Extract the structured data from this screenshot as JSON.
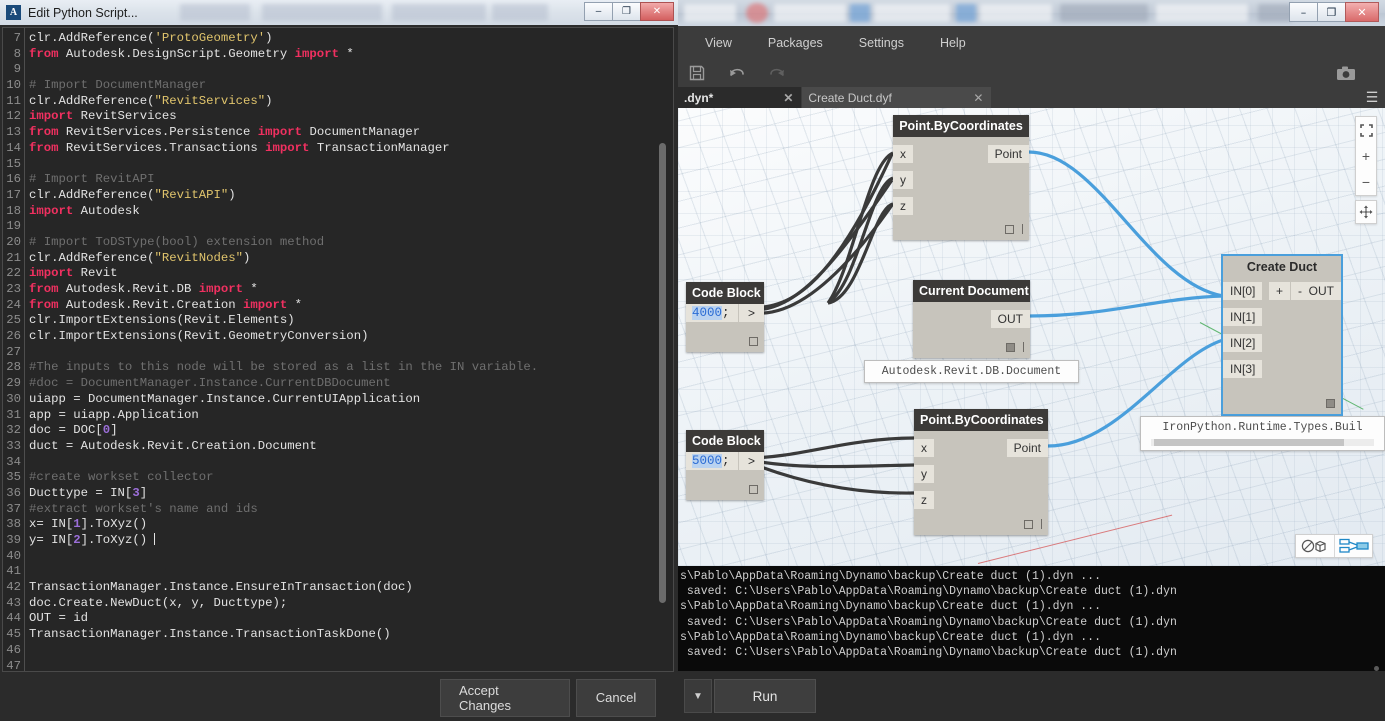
{
  "python_editor": {
    "title": "Edit Python Script...",
    "icon": "autodesk-logo-icon",
    "window_buttons": {
      "minimize": "–",
      "maximize": "❐",
      "close": "✕"
    },
    "accept_label": "Accept Changes",
    "cancel_label": "Cancel",
    "code_lines": [
      {
        "n": "7",
        "tokens": [
          {
            "t": "clr.AddReference(",
            "c": "plain"
          },
          {
            "t": "'ProtoGeometry'",
            "c": "str"
          },
          {
            "t": ")",
            "c": "plain"
          }
        ]
      },
      {
        "n": "8",
        "tokens": [
          {
            "t": "from",
            "c": "kw"
          },
          {
            "t": " Autodesk.DesignScript.Geometry ",
            "c": "plain"
          },
          {
            "t": "import",
            "c": "kw"
          },
          {
            "t": " *",
            "c": "plain"
          }
        ]
      },
      {
        "n": "9",
        "tokens": []
      },
      {
        "n": "10",
        "tokens": [
          {
            "t": "# Import DocumentManager",
            "c": "com"
          }
        ]
      },
      {
        "n": "11",
        "tokens": [
          {
            "t": "clr.AddReference(",
            "c": "plain"
          },
          {
            "t": "\"RevitServices\"",
            "c": "str"
          },
          {
            "t": ")",
            "c": "plain"
          }
        ]
      },
      {
        "n": "12",
        "tokens": [
          {
            "t": "import",
            "c": "kw"
          },
          {
            "t": " RevitServices",
            "c": "plain"
          }
        ]
      },
      {
        "n": "13",
        "tokens": [
          {
            "t": "from",
            "c": "kw"
          },
          {
            "t": " RevitServices.Persistence ",
            "c": "plain"
          },
          {
            "t": "import",
            "c": "kw"
          },
          {
            "t": " DocumentManager",
            "c": "plain"
          }
        ]
      },
      {
        "n": "14",
        "tokens": [
          {
            "t": "from",
            "c": "kw"
          },
          {
            "t": " RevitServices.Transactions ",
            "c": "plain"
          },
          {
            "t": "import",
            "c": "kw"
          },
          {
            "t": " TransactionManager",
            "c": "plain"
          }
        ]
      },
      {
        "n": "15",
        "tokens": []
      },
      {
        "n": "16",
        "tokens": [
          {
            "t": "# Import RevitAPI",
            "c": "com"
          }
        ]
      },
      {
        "n": "17",
        "tokens": [
          {
            "t": "clr.AddReference(",
            "c": "plain"
          },
          {
            "t": "\"RevitAPI\"",
            "c": "str"
          },
          {
            "t": ")",
            "c": "plain"
          }
        ]
      },
      {
        "n": "18",
        "tokens": [
          {
            "t": "import",
            "c": "kw"
          },
          {
            "t": " Autodesk",
            "c": "plain"
          }
        ]
      },
      {
        "n": "19",
        "tokens": []
      },
      {
        "n": "20",
        "tokens": [
          {
            "t": "# Import ToDSType(bool) extension method",
            "c": "com"
          }
        ]
      },
      {
        "n": "21",
        "tokens": [
          {
            "t": "clr.AddReference(",
            "c": "plain"
          },
          {
            "t": "\"RevitNodes\"",
            "c": "str"
          },
          {
            "t": ")",
            "c": "plain"
          }
        ]
      },
      {
        "n": "22",
        "tokens": [
          {
            "t": "import",
            "c": "kw"
          },
          {
            "t": " Revit",
            "c": "plain"
          }
        ]
      },
      {
        "n": "23",
        "tokens": [
          {
            "t": "from",
            "c": "kw"
          },
          {
            "t": " Autodesk.Revit.DB ",
            "c": "plain"
          },
          {
            "t": "import",
            "c": "kw"
          },
          {
            "t": " *",
            "c": "plain"
          }
        ]
      },
      {
        "n": "24",
        "tokens": [
          {
            "t": "from",
            "c": "kw"
          },
          {
            "t": " Autodesk.Revit.Creation ",
            "c": "plain"
          },
          {
            "t": "import",
            "c": "kw"
          },
          {
            "t": " *",
            "c": "plain"
          }
        ]
      },
      {
        "n": "25",
        "tokens": [
          {
            "t": "clr.ImportExtensions(Revit.Elements)",
            "c": "plain"
          }
        ]
      },
      {
        "n": "26",
        "tokens": [
          {
            "t": "clr.ImportExtensions(Revit.GeometryConversion)",
            "c": "plain"
          }
        ]
      },
      {
        "n": "27",
        "tokens": []
      },
      {
        "n": "28",
        "tokens": [
          {
            "t": "#The inputs to this node will be stored as a list in the IN variable.",
            "c": "com"
          }
        ]
      },
      {
        "n": "29",
        "tokens": [
          {
            "t": "#doc = DocumentManager.Instance.CurrentDBDocument",
            "c": "com"
          }
        ]
      },
      {
        "n": "30",
        "tokens": [
          {
            "t": "uiapp = DocumentManager.Instance.CurrentUIApplication",
            "c": "plain"
          }
        ]
      },
      {
        "n": "31",
        "tokens": [
          {
            "t": "app = uiapp.Application",
            "c": "plain"
          }
        ]
      },
      {
        "n": "32",
        "tokens": [
          {
            "t": "doc = DOC[",
            "c": "plain"
          },
          {
            "t": "0",
            "c": "num"
          },
          {
            "t": "]",
            "c": "plain"
          }
        ]
      },
      {
        "n": "33",
        "tokens": [
          {
            "t": "duct = Autodesk.Revit.Creation.Document",
            "c": "plain"
          }
        ]
      },
      {
        "n": "34",
        "tokens": []
      },
      {
        "n": "35",
        "tokens": [
          {
            "t": "#create workset collector",
            "c": "com"
          }
        ]
      },
      {
        "n": "36",
        "tokens": [
          {
            "t": "Ducttype = IN[",
            "c": "plain"
          },
          {
            "t": "3",
            "c": "num"
          },
          {
            "t": "]",
            "c": "plain"
          }
        ]
      },
      {
        "n": "37",
        "tokens": [
          {
            "t": "#extract workset's name and ids",
            "c": "com"
          }
        ]
      },
      {
        "n": "38",
        "tokens": [
          {
            "t": "x= IN[",
            "c": "plain"
          },
          {
            "t": "1",
            "c": "num"
          },
          {
            "t": "].ToXyz()",
            "c": "plain"
          }
        ]
      },
      {
        "n": "39",
        "tokens": [
          {
            "t": "y= IN[",
            "c": "plain"
          },
          {
            "t": "2",
            "c": "num"
          },
          {
            "t": "].ToXyz() ",
            "c": "plain"
          },
          {
            "t": "|",
            "c": "caret"
          }
        ]
      },
      {
        "n": "40",
        "tokens": []
      },
      {
        "n": "41",
        "tokens": []
      },
      {
        "n": "42",
        "tokens": [
          {
            "t": "TransactionManager.Instance.EnsureInTransaction(doc)",
            "c": "plain"
          }
        ]
      },
      {
        "n": "43",
        "tokens": [
          {
            "t": "doc.Create.NewDuct(x, y, Ducttype);",
            "c": "plain"
          }
        ]
      },
      {
        "n": "44",
        "tokens": [
          {
            "t": "OUT = id",
            "c": "plain"
          }
        ]
      },
      {
        "n": "45",
        "tokens": [
          {
            "t": "TransactionManager.Instance.TransactionTaskDone()",
            "c": "plain"
          }
        ]
      },
      {
        "n": "46",
        "tokens": []
      },
      {
        "n": "47",
        "tokens": []
      }
    ]
  },
  "dynamo": {
    "window_buttons": {
      "minimize": "–",
      "maximize": "❐",
      "close": "✕"
    },
    "menu": [
      "View",
      "Packages",
      "Settings",
      "Help"
    ],
    "toolbar": {
      "save": "save-icon",
      "undo": "undo-icon",
      "redo": "redo-icon",
      "screenshot": "camera-icon"
    },
    "tabs": [
      {
        "label": ".dyn*",
        "close": "✕",
        "active": true
      },
      {
        "label": "Create Duct.dyf",
        "close": "✕",
        "active": false
      }
    ],
    "menu_burger": "☰",
    "canvas": {
      "nodes": [
        {
          "id": "point-by-coordinates-1",
          "title": "Point.ByCoordinates",
          "inputs": [
            "x",
            "y",
            "z"
          ],
          "outputs": [
            "Point"
          ],
          "selected": false
        },
        {
          "id": "code-block-1",
          "title": "Code Block",
          "expression": "4000",
          "terminator": ";",
          "arrow": ">",
          "selected": false
        },
        {
          "id": "current-document",
          "title": "Current Document",
          "inputs": [],
          "outputs": [
            "OUT"
          ],
          "selected": false
        },
        {
          "id": "create-duct",
          "title": "Create Duct",
          "inputs": [
            "IN[0]",
            "IN[1]",
            "IN[2]",
            "IN[3]"
          ],
          "outputs": [
            "OUT"
          ],
          "add_port": "+",
          "remove_port": "-",
          "selected": true
        },
        {
          "id": "code-block-2",
          "title": "Code Block",
          "expression": "5000",
          "terminator": ";",
          "arrow": ">",
          "selected": false
        },
        {
          "id": "point-by-coordinates-2",
          "title": "Point.ByCoordinates",
          "inputs": [
            "x",
            "y",
            "z"
          ],
          "outputs": [
            "Point"
          ],
          "selected": false
        }
      ],
      "tooltips": [
        {
          "id": "current-document-preview",
          "text": "Autodesk.Revit.DB.Document"
        },
        {
          "id": "create-duct-preview",
          "text": "IronPython.Runtime.Types.Buil"
        }
      ],
      "zoom_controls": {
        "fit": "fit-to-screen-icon",
        "zoom_in": "+",
        "zoom_out": "−",
        "pan": "pan-icon"
      },
      "view_toggle": {
        "geometry": "geometry-view-icon",
        "graph": "graph-view-icon"
      }
    },
    "console_lines": [
      "s\\Pablo\\AppData\\Roaming\\Dynamo\\backup\\Create duct (1).dyn ...",
      " saved: C:\\Users\\Pablo\\AppData\\Roaming\\Dynamo\\backup\\Create duct (1).dyn",
      "s\\Pablo\\AppData\\Roaming\\Dynamo\\backup\\Create duct (1).dyn ...",
      " saved: C:\\Users\\Pablo\\AppData\\Roaming\\Dynamo\\backup\\Create duct (1).dyn",
      "s\\Pablo\\AppData\\Roaming\\Dynamo\\backup\\Create duct (1).dyn ...",
      " saved: C:\\Users\\Pablo\\AppData\\Roaming\\Dynamo\\backup\\Create duct (1).dyn"
    ],
    "run_bar": {
      "caret": "▼",
      "run_label": "Run"
    }
  },
  "colors": {
    "node_header": "#3c3a38",
    "node_body": "#c7c4bc",
    "port": "#e6e3db",
    "selection": "#4a9fdc",
    "wire": "#3d3d3d",
    "wire_active": "#4a9fdc",
    "console_bg": "#0a0a0a",
    "editor_bg": "#262626"
  }
}
